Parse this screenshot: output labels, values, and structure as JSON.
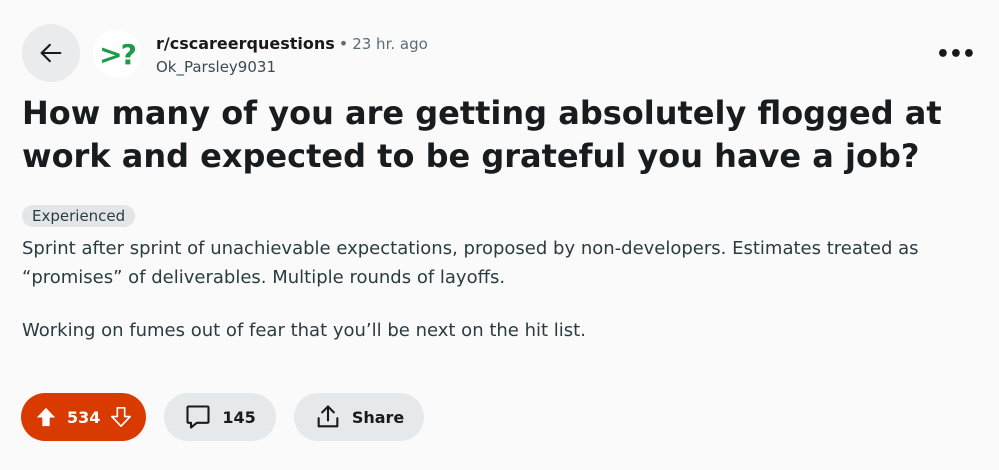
{
  "header": {
    "back_icon": "arrow-left-icon",
    "avatar_glyph": ">?",
    "subreddit": "r/cscareerquestions",
    "separator": "•",
    "time": "23 hr. ago",
    "author": "Ok_Parsley9031",
    "more_label": "•••"
  },
  "post": {
    "title": "How many of you are getting absolutely flogged at work and expected to be grateful you have a job?",
    "flair": "Experienced",
    "paragraphs": [
      "Sprint after sprint of unachievable expectations, proposed by non-developers. Estimates treated as “promises” of deliverables. Multiple rounds of layoffs.",
      "Working on fumes out of fear that you’ll be next on the hit list."
    ]
  },
  "actions": {
    "votes": "534",
    "comments": "145",
    "share_label": "Share"
  },
  "colors": {
    "upvote_active": "#d93a00",
    "avatar_green": "#1c9b4b",
    "pill_bg": "#e5e9eb"
  }
}
